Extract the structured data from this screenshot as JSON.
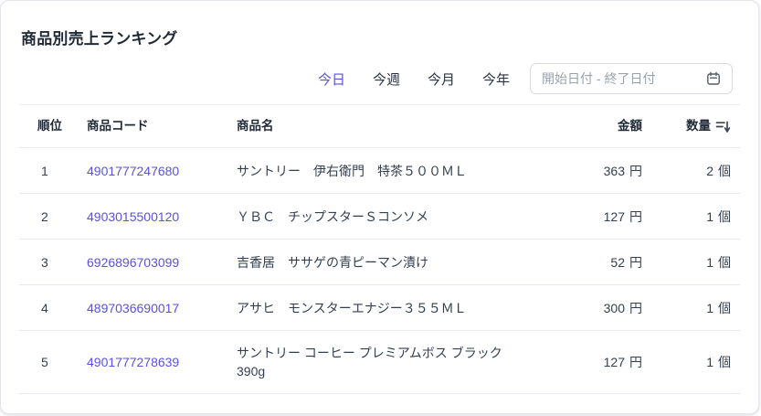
{
  "card": {
    "title": "商品別売上ランキング"
  },
  "filters": {
    "tabs": [
      {
        "label": "今日",
        "active": true
      },
      {
        "label": "今週",
        "active": false
      },
      {
        "label": "今月",
        "active": false
      },
      {
        "label": "今年",
        "active": false
      }
    ],
    "date_range": {
      "placeholder": "開始日付 - 終了日付",
      "icon": "calendar-icon"
    }
  },
  "table": {
    "headers": {
      "rank": "順位",
      "code": "商品コード",
      "name": "商品名",
      "amount": "金額",
      "quantity": "数量"
    },
    "sort_icon": "sort-descending-icon",
    "units": {
      "amount": "円",
      "quantity": "個"
    },
    "rows": [
      {
        "rank": "1",
        "code": "4901777247680",
        "name": "サントリー　伊右衛門　特茶５００ＭＬ",
        "amount": "363",
        "quantity": "2"
      },
      {
        "rank": "2",
        "code": "4903015500120",
        "name": "ＹＢＣ　チップスターＳコンソメ",
        "amount": "127",
        "quantity": "1"
      },
      {
        "rank": "3",
        "code": "6926896703099",
        "name": "吉香居　ササゲの青ピーマン漬け",
        "amount": "52",
        "quantity": "1"
      },
      {
        "rank": "4",
        "code": "4897036690017",
        "name": "アサヒ　モンスターエナジー３５５ＭＬ",
        "amount": "300",
        "quantity": "1"
      },
      {
        "rank": "5",
        "code": "4901777278639",
        "name": "サントリー コーヒー プレミアムボス ブラック 390g",
        "amount": "127",
        "quantity": "1"
      }
    ]
  },
  "colors": {
    "accent": "#5a52df",
    "heading_text": "#1f2937",
    "body_text": "#333f50",
    "placeholder": "#9aa1ad",
    "divider": "#e7e9ee"
  }
}
